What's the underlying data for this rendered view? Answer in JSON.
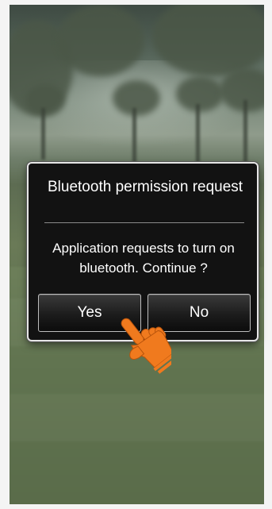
{
  "dialog": {
    "title": "Bluetooth permission request",
    "message": "Application requests to turn on bluetooth. Continue ?",
    "yes_label": "Yes",
    "no_label": "No"
  },
  "colors": {
    "dialog_background": "#121212",
    "dialog_border": "#e6e6e6",
    "text": "#ffffff",
    "tap_hand": "#f07a1e"
  },
  "icons": {
    "tap_indicator": "pointing-hand-icon"
  }
}
